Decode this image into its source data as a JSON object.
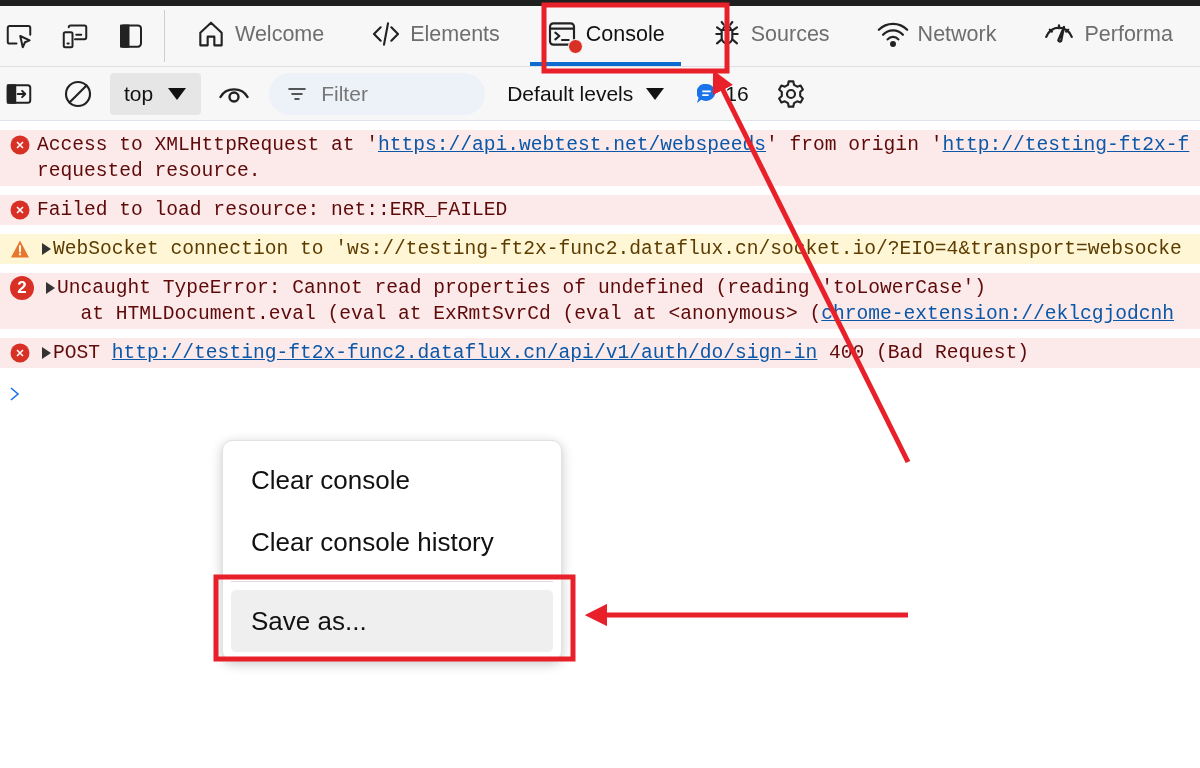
{
  "tabs": [
    {
      "label": "Welcome",
      "selected": false,
      "error_badge": false
    },
    {
      "label": "Elements",
      "selected": false,
      "error_badge": false
    },
    {
      "label": "Console",
      "selected": true,
      "error_badge": true
    },
    {
      "label": "Sources",
      "selected": false,
      "error_badge": false
    },
    {
      "label": "Network",
      "selected": false,
      "error_badge": false
    },
    {
      "label": "Performa",
      "selected": false,
      "error_badge": false
    }
  ],
  "toolbar": {
    "context": "top",
    "filter": {
      "placeholder": "Filter"
    },
    "levels": "Default levels",
    "message_count": "16"
  },
  "messages": [
    {
      "kind": "error",
      "expandable": false,
      "lines": [
        [
          {
            "kind": "text",
            "text": "Access to XMLHttpRequest at '"
          },
          {
            "kind": "link",
            "text": "https://api.webtest.net/webspeeds"
          },
          {
            "kind": "text",
            "text": "' from origin '"
          },
          {
            "kind": "link",
            "text": "http://testing-ft2x-f"
          }
        ],
        [
          {
            "kind": "text",
            "text": "requested resource."
          }
        ]
      ]
    },
    {
      "kind": "error",
      "expandable": false,
      "lines": [
        [
          {
            "kind": "text",
            "text": "Failed to load resource: net::ERR_FAILED"
          }
        ]
      ]
    },
    {
      "kind": "warning",
      "expandable": true,
      "lines": [
        [
          {
            "kind": "text",
            "text": "WebSocket connection to 'ws://testing-ft2x-func2.dataflux.cn/socket.io/?EIO=4&transport=websocke"
          }
        ]
      ]
    },
    {
      "kind": "error",
      "count": "2",
      "expandable": true,
      "lines": [
        [
          {
            "kind": "text",
            "text": "Uncaught TypeError: Cannot read properties of undefined (reading 'toLowerCase')"
          }
        ],
        [
          {
            "kind": "text",
            "text": "  at HTMLDocument.eval (eval at ExRmtSvrCd (eval at <anonymous> ("
          },
          {
            "kind": "link",
            "text": "chrome-extension://eklcgjodcnh"
          }
        ]
      ]
    },
    {
      "kind": "error",
      "expandable": true,
      "lines": [
        [
          {
            "kind": "text",
            "text": "POST "
          },
          {
            "kind": "link",
            "text": "http://testing-ft2x-func2.dataflux.cn/api/v1/auth/do/sign-in"
          },
          {
            "kind": "text",
            "text": " 400 (Bad Request)"
          }
        ]
      ]
    }
  ],
  "context_menu": [
    {
      "kind": "item",
      "label": "Clear console",
      "selected": false
    },
    {
      "kind": "item",
      "label": "Clear console history",
      "selected": false
    },
    {
      "kind": "separator"
    },
    {
      "kind": "item",
      "label": "Save as...",
      "selected": true
    }
  ]
}
